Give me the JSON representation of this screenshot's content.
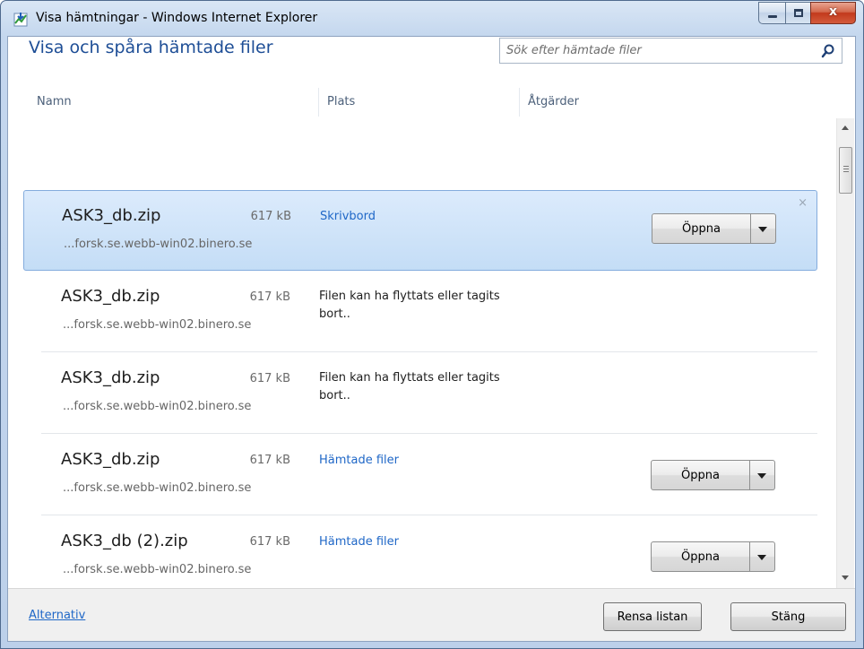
{
  "window": {
    "title": "Visa hämtningar - Windows Internet Explorer",
    "caption_min": "‒",
    "caption_max": "□",
    "caption_close": "x"
  },
  "header": {
    "title": "Visa och spåra hämtade filer",
    "search_placeholder": "Sök efter hämtade filer"
  },
  "columns": {
    "name": "Namn",
    "location": "Plats",
    "actions": "Åtgärder"
  },
  "downloads": [
    {
      "name": "ASK3_db.zip",
      "size": "617 kB",
      "source": "...forsk.se.webb-win02.binero.se",
      "location": "Skrivbord",
      "location_is_link": true,
      "action": "Öppna",
      "selected": true,
      "remove": "×"
    },
    {
      "name": "ASK3_db.zip",
      "size": "617 kB",
      "source": "...forsk.se.webb-win02.binero.se",
      "location": "Filen kan ha flyttats eller tagits bort..",
      "location_is_link": false,
      "action": ""
    },
    {
      "name": "ASK3_db.zip",
      "size": "617 kB",
      "source": "...forsk.se.webb-win02.binero.se",
      "location": "Filen kan ha flyttats eller tagits bort..",
      "location_is_link": false,
      "action": ""
    },
    {
      "name": "ASK3_db.zip",
      "size": "617 kB",
      "source": "...forsk.se.webb-win02.binero.se",
      "location": "Hämtade filer",
      "location_is_link": true,
      "action": "Öppna"
    },
    {
      "name": "ASK3_db (2).zip",
      "size": "617 kB",
      "source": "...forsk.se.webb-win02.binero.se",
      "location": "Hämtade filer",
      "location_is_link": true,
      "action": "Öppna"
    }
  ],
  "footer": {
    "options_link": "Alternativ",
    "clear_button": "Rensa listan",
    "close_button": "Stäng"
  },
  "colors": {
    "heading": "#1e4e96",
    "link": "#1f67c7",
    "selected_row": "#c4ddf6"
  }
}
